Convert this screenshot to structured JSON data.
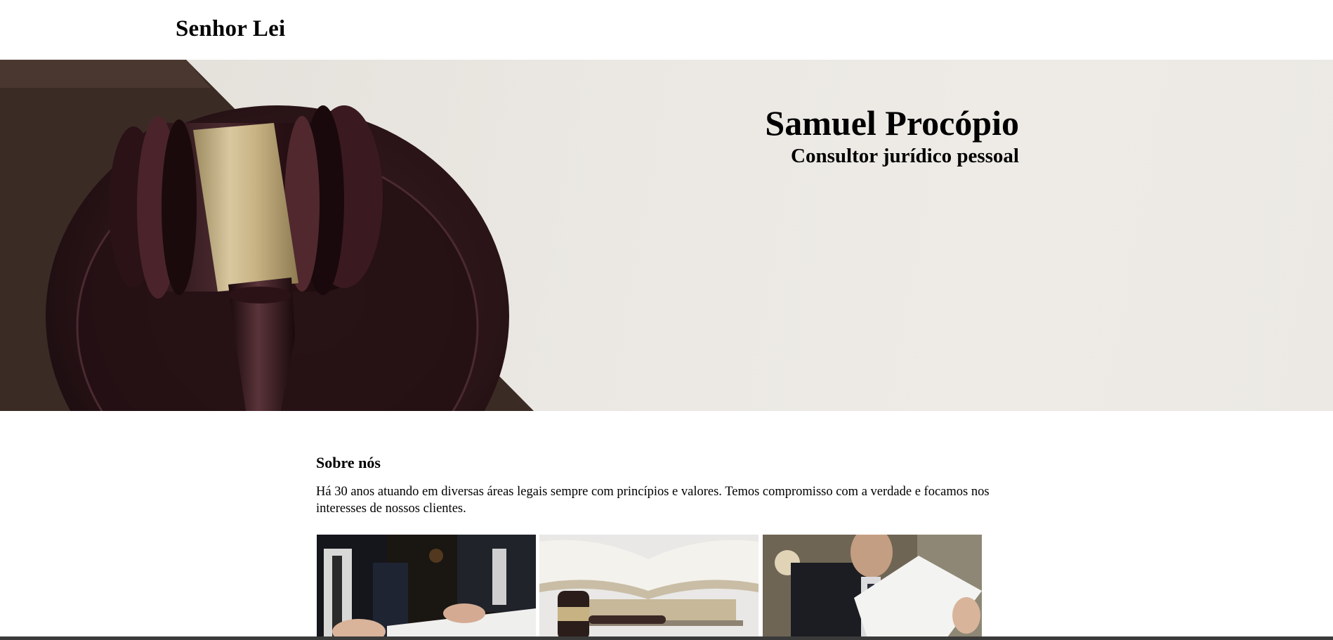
{
  "header": {
    "brand": "Senhor Lei"
  },
  "hero": {
    "name": "Samuel Procópio",
    "role": "Consultor jurídico pessoal",
    "image": "gavel-on-sound-block"
  },
  "about": {
    "title": "Sobre nós",
    "text": "Há 30 anos atuando em diversas áreas legais sempre com princípios e valores. Temos compromisso com a verdade e focamos nos interesses de nossos clientes."
  },
  "gallery": [
    {
      "image": "lawyers-signing-document"
    },
    {
      "image": "books-and-gavel"
    },
    {
      "image": "lawyer-reading-paper"
    }
  ]
}
